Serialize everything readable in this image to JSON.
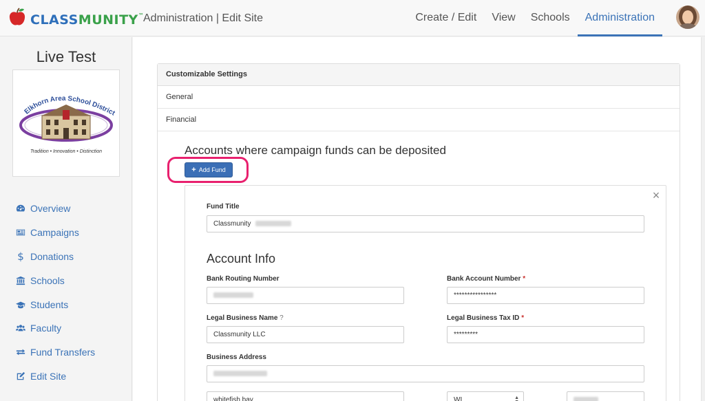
{
  "brand": {
    "logo_part1": "CLASS",
    "logo_part2": "MUNITY",
    "logo_tm": "™",
    "accent_color": "#3b73b7"
  },
  "header": {
    "page_heading": "Administration | Edit Site",
    "nav": [
      {
        "label": "Create / Edit",
        "active": false
      },
      {
        "label": "View",
        "active": false
      },
      {
        "label": "Schools",
        "active": false
      },
      {
        "label": "Administration",
        "active": true
      }
    ]
  },
  "sidebar": {
    "site_name": "Live Test",
    "district_logo": {
      "name": "Elkhorn Area School District",
      "tagline": "Tradition • Innovation • Distinction"
    },
    "items": [
      {
        "label": "Overview",
        "icon": "dashboard-icon"
      },
      {
        "label": "Campaigns",
        "icon": "campaigns-icon"
      },
      {
        "label": "Donations",
        "icon": "dollar-icon"
      },
      {
        "label": "Schools",
        "icon": "school-icon"
      },
      {
        "label": "Students",
        "icon": "graduation-cap-icon"
      },
      {
        "label": "Faculty",
        "icon": "users-icon"
      },
      {
        "label": "Fund Transfers",
        "icon": "exchange-icon"
      },
      {
        "label": "Edit Site",
        "icon": "edit-icon"
      }
    ]
  },
  "settings": {
    "panel_title": "Customizable Settings",
    "sections": [
      "General",
      "Financial"
    ],
    "accounts_title": "Accounts where campaign funds can be deposited",
    "add_fund_label": "Add Fund",
    "fund": {
      "title_label": "Fund Title",
      "title_value": "Classmunity",
      "account_info_heading": "Account Info",
      "routing_label": "Bank Routing Number",
      "account_number_label": "Bank Account Number",
      "account_number_value": "****************",
      "legal_name_label": "Legal Business Name",
      "legal_name_help": "?",
      "legal_name_value": "Classmunity LLC",
      "tax_id_label": "Legal Business Tax ID",
      "tax_id_value": "*********",
      "required_mark": "*",
      "address_label": "Business Address",
      "city_value": "whitefish bay",
      "state_value": "WI"
    }
  }
}
